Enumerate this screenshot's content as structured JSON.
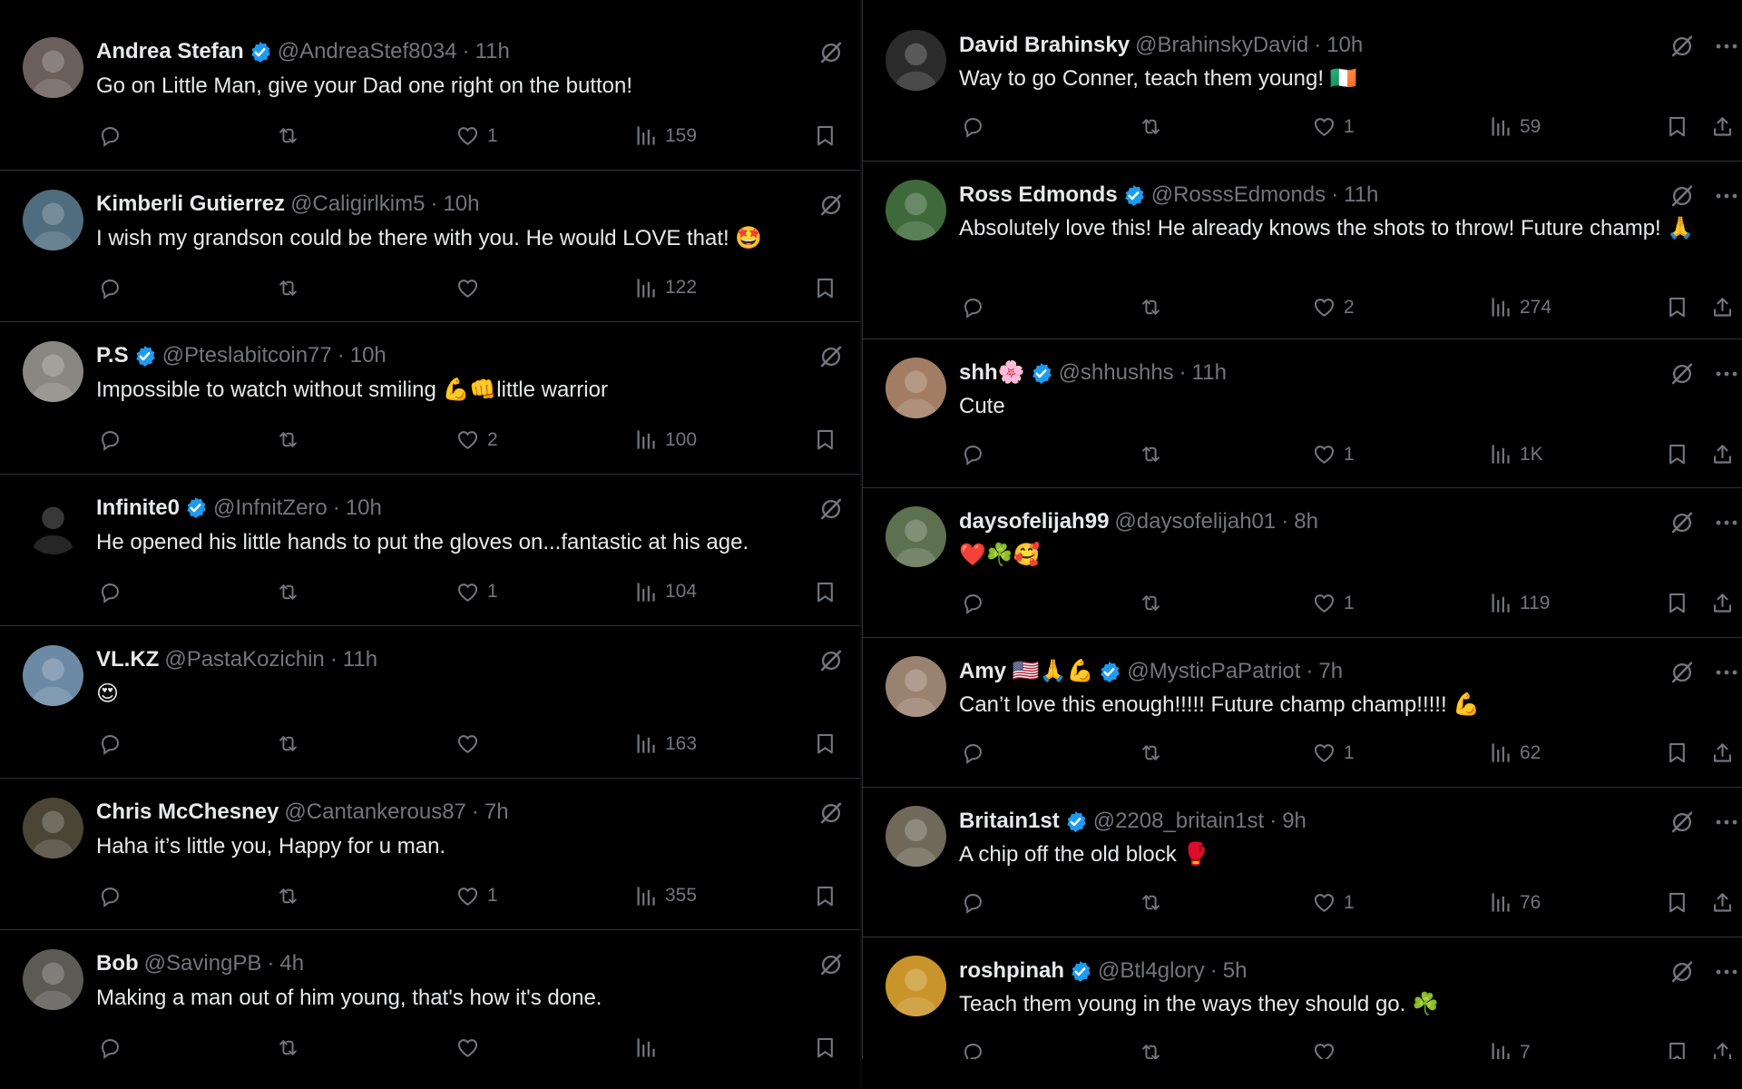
{
  "left_replies": [
    {
      "name": "Andrea Stefan",
      "verified": true,
      "handle": "@AndreaStef8034",
      "time": "11h",
      "text": "Go on Little Man, give your Dad one right on the button!",
      "likes": "1",
      "views": "159",
      "avatar_color": "#6b5f5b"
    },
    {
      "name": "Kimberli Gutierrez",
      "verified": false,
      "handle": "@Caligirlkim5",
      "time": "10h",
      "text": "I wish my grandson could be there with you. He would LOVE that! 🤩",
      "likes": "",
      "views": "122",
      "avatar_color": "#4f6d7e"
    },
    {
      "name": "P.S",
      "verified": true,
      "handle": "@Pteslabitcoin77",
      "time": "10h",
      "text": "Impossible to watch without smiling 💪👊little warrior",
      "likes": "2",
      "views": "100",
      "avatar_color": "#8a8682"
    },
    {
      "name": "Infinite0",
      "verified": true,
      "handle": "@InfnitZero",
      "time": "10h",
      "text": "He opened his little hands to put the gloves on...fantastic at his age.",
      "likes": "1",
      "views": "104",
      "avatar_color": "#000000"
    },
    {
      "name": "VL.KZ",
      "verified": false,
      "handle": "@PastaKozichin",
      "time": "11h",
      "text": "😍",
      "likes": "",
      "views": "163",
      "avatar_color": "#6c8aa6"
    },
    {
      "name": "Chris McChesney",
      "verified": false,
      "handle": "@Cantankerous87",
      "time": "7h",
      "text": "Haha it’s little you, Happy for u man.",
      "likes": "1",
      "views": "355",
      "avatar_color": "#4a4535"
    },
    {
      "name": "Bob",
      "verified": false,
      "handle": "@SavingPB",
      "time": "4h",
      "text": "Making a man out of him young, that's how it's done.",
      "likes": "",
      "views": "",
      "avatar_color": "#5b5a55"
    }
  ],
  "right_replies": [
    {
      "name": "David Brahinsky",
      "verified": false,
      "handle": "@BrahinskyDavid",
      "time": "10h",
      "text": "Way to go Conner, teach them young! 🇮🇪",
      "likes": "1",
      "views": "59",
      "avatar_color": "#2b2b2b"
    },
    {
      "name": "Ross Edmonds",
      "verified": true,
      "handle": "@RosssEdmonds",
      "time": "11h",
      "text": "Absolutely love this! He already knows the shots to throw! Future champ! 🙏",
      "likes": "2",
      "views": "274",
      "avatar_color": "#3e6a3b"
    },
    {
      "name": "shh🌸",
      "verified": true,
      "handle": "@shhushhs",
      "time": "11h",
      "text": "Cute",
      "likes": "1",
      "views": "1K",
      "avatar_color": "#a27d63"
    },
    {
      "name": "daysofelijah99",
      "verified": false,
      "handle": "@daysofelijah01",
      "time": "8h",
      "text": "❤️☘️🥰",
      "likes": "1",
      "views": "119",
      "avatar_color": "#5d7150"
    },
    {
      "name": "Amy 🇺🇸🙏💪",
      "verified": true,
      "handle": "@MysticPaPatriot",
      "time": "7h",
      "text": "Can’t love this enough!!!!!  Future champ champ!!!!! 💪",
      "likes": "1",
      "views": "62",
      "avatar_color": "#9a8270"
    },
    {
      "name": "Britain1st",
      "verified": true,
      "handle": "@2208_britain1st",
      "time": "9h",
      "text": "A chip off the old block 🥊",
      "likes": "1",
      "views": "76",
      "avatar_color": "#70695a"
    },
    {
      "name": "roshpinah",
      "verified": true,
      "handle": "@Btl4glory",
      "time": "5h",
      "text": "Teach them young in the ways they should go. ☘️",
      "likes": "",
      "views": "7",
      "avatar_color": "#c9952a"
    }
  ],
  "icons": {
    "reply": "reply-icon",
    "retweet": "retweet-icon",
    "like": "heart-icon",
    "views": "views-icon",
    "bookmark": "bookmark-icon",
    "share": "share-icon",
    "grok": "grok-icon",
    "more": "more-icon",
    "verified": "verified-badge-icon"
  },
  "colors": {
    "background": "#000000",
    "text": "#e7e9ea",
    "muted": "#71767b",
    "verified": "#1d9bf0",
    "divider": "#2f3336"
  }
}
